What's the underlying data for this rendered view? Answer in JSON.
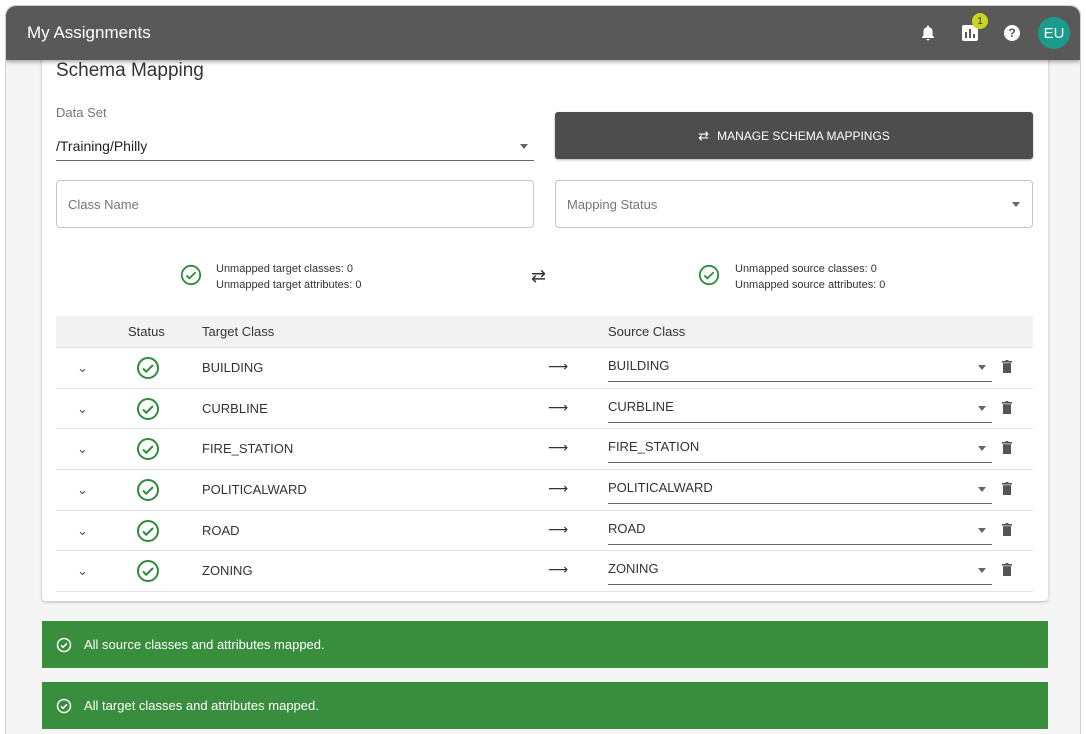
{
  "header": {
    "title": "My Assignments",
    "notification_count": "1",
    "help_glyph": "?",
    "avatar_initials": "EU",
    "icons": [
      "bell-icon",
      "chart-icon",
      "help-icon"
    ]
  },
  "colors": {
    "topbar": "#595959",
    "avatar": "#1a9c8c",
    "badge": "#c8d41f",
    "success": "#388e3c",
    "check": "#2e8b3a",
    "button": "#4d4d4d"
  },
  "schema": {
    "title": "Schema Mapping",
    "dataset_label": "Data Set",
    "dataset_value": "/Training/Philly",
    "manage_button": "MANAGE SCHEMA MAPPINGS",
    "class_name_placeholder": "Class Name",
    "mapping_status_placeholder": "Mapping Status"
  },
  "summary": {
    "target_line1": "Unmapped target classes: 0",
    "target_line2": "Unmapped target attributes: 0",
    "source_line1": "Unmapped source classes: 0",
    "source_line2": "Unmapped source attributes: 0"
  },
  "table": {
    "headers": {
      "status": "Status",
      "target": "Target Class",
      "source": "Source Class"
    },
    "rows": [
      {
        "target": "BUILDING",
        "source": "BUILDING"
      },
      {
        "target": "CURBLINE",
        "source": "CURBLINE"
      },
      {
        "target": "FIRE_STATION",
        "source": "FIRE_STATION"
      },
      {
        "target": "POLITICALWARD",
        "source": "POLITICALWARD"
      },
      {
        "target": "ROAD",
        "source": "ROAD"
      },
      {
        "target": "ZONING",
        "source": "ZONING"
      }
    ]
  },
  "banners": {
    "source_msg": "All source classes and attributes mapped.",
    "target_msg": "All target classes and attributes mapped."
  }
}
